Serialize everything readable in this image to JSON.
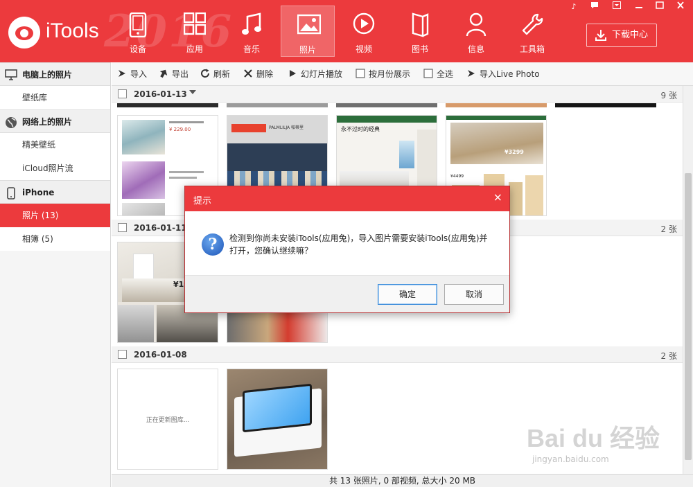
{
  "app": {
    "logo_text": "iTools",
    "decor_year": "2016"
  },
  "nav": {
    "items": [
      {
        "label": "设备",
        "icon": "device-icon"
      },
      {
        "label": "应用",
        "icon": "apps-icon"
      },
      {
        "label": "音乐",
        "icon": "music-icon"
      },
      {
        "label": "照片",
        "icon": "photo-icon",
        "active": true
      },
      {
        "label": "视频",
        "icon": "video-icon"
      },
      {
        "label": "图书",
        "icon": "book-icon"
      },
      {
        "label": "信息",
        "icon": "user-icon"
      },
      {
        "label": "工具箱",
        "icon": "toolbox-icon"
      }
    ],
    "download_label": "下载中心"
  },
  "window_controls": [
    "music-note-icon",
    "chat-icon",
    "menu-icon",
    "minimize-icon",
    "maximize-icon",
    "close-icon"
  ],
  "sidebar": {
    "groups": [
      {
        "title": "电脑上的照片",
        "icon": "monitor-icon",
        "items": [
          "壁纸库"
        ]
      },
      {
        "title": "网络上的照片",
        "icon": "globe-icon",
        "items": [
          "精美壁纸",
          "iCloud照片流"
        ]
      },
      {
        "title": "iPhone",
        "icon": "phone-icon",
        "items": [
          "照片 (13)",
          "相簿 (5)"
        ]
      }
    ],
    "active_item": "照片 (13)"
  },
  "toolbar": {
    "import": "导入",
    "export": "导出",
    "refresh": "刷新",
    "delete": "删除",
    "slideshow": "幻灯片播放",
    "by_month": "按月份展示",
    "select_all": "全选",
    "import_live": "导入Live Photo"
  },
  "groups": [
    {
      "date": "2016-01-13",
      "count": "9 张"
    },
    {
      "date": "2016-01-11",
      "count": "2 张"
    },
    {
      "date": "2016-01-08",
      "count": "2 张"
    }
  ],
  "thumbnails": {
    "updating_text": "正在更新图库...",
    "t2_price": "¥ 229.00",
    "t3_banner": "PALMLILJA 帕蒂里",
    "t4_caption": "永不过时的经典",
    "t5_price": "¥3299",
    "t5_price2": "¥4499",
    "t7_price": "¥19"
  },
  "status": {
    "summary": "共 13 张照片, 0 部视频, 总大小 20 MB"
  },
  "dialog": {
    "title": "提示",
    "close": "×",
    "icon_glyph": "?",
    "message": "检测到你尚未安装iTools(应用兔)，导入图片需要安装iTools(应用兔)并打开，您确认继续嘛？",
    "ok": "确定",
    "cancel": "取消"
  },
  "watermark": {
    "main": "Bai du 经验",
    "sub": "jingyan.baidu.com"
  },
  "colors": {
    "brand": "#ec3a3d",
    "selected": "#ec3a3d"
  }
}
